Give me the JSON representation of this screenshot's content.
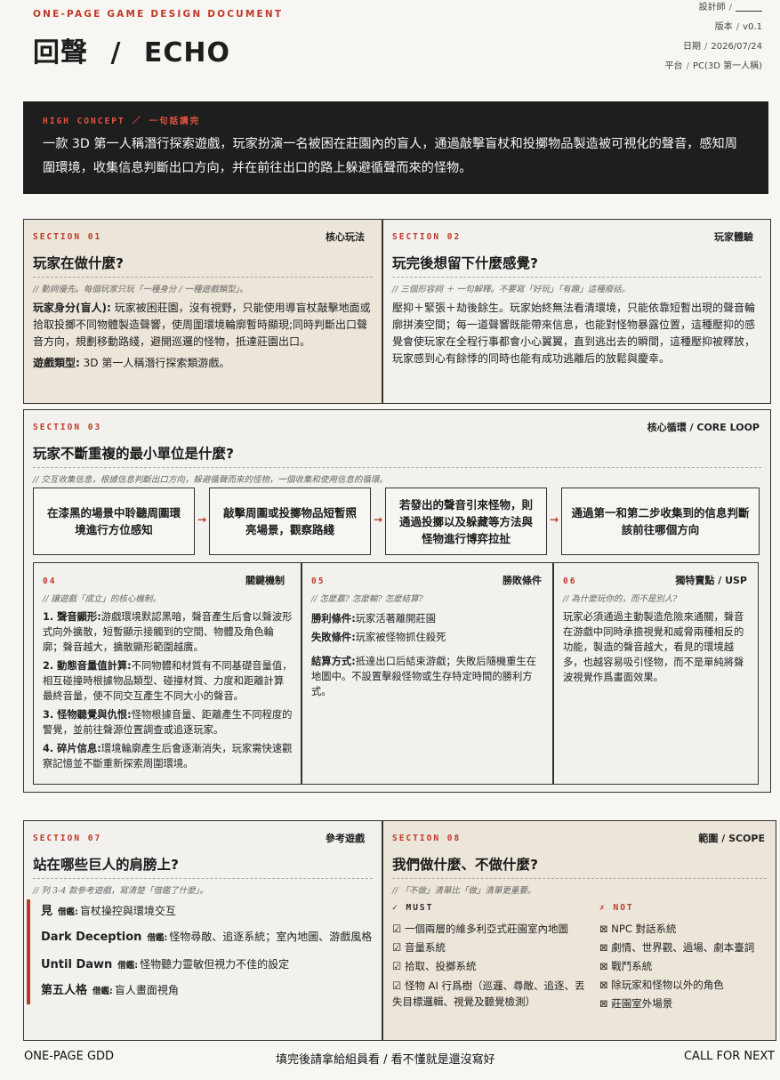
{
  "header": {
    "doc_label": "ONE-PAGE GAME DESIGN DOCUMENT",
    "title_cn": "回聲",
    "title_sep": "/",
    "title_en": "ECHO",
    "meta": [
      {
        "label": "設計師",
        "value": ""
      },
      {
        "label": "版本",
        "value": "v0.1"
      },
      {
        "label": "日期",
        "value": "2026/07/24"
      },
      {
        "label": "平台",
        "value": "PC(3D 第一人稱)"
      }
    ]
  },
  "high_concept": {
    "label": "HIGH CONCEPT ／ 一句話講完",
    "text": "一款 3D 第一人稱潛行探索遊戲，玩家扮演一名被困在莊園內的盲人，通過敲擊盲杖和投擲物品製造被可視化的聲音，感知周圍環境，收集信息判斷出口方向，并在前往出口的路上躲避循聲而來的怪物。"
  },
  "sec01": {
    "label": "SECTION 01",
    "tag": "核心玩法",
    "title": "玩家在做什麼?",
    "sub": "// 動詞優先。每個玩家只玩「一種身分 / 一種遊戲類型」。",
    "role_label": "玩家身分(盲人):",
    "role_text": " 玩家被困莊園，沒有視野，只能使用導盲杖敲擊地面或拾取投擲不同物體製造聲響，使周圍環境輪廓暫時顯現;同時判斷出口聲音方向，規劃移動路綫，避開巡邏的怪物，抵達莊園出口。",
    "genre_label": "遊戲類型:",
    "genre_text": " 3D 第一人稱潛行探索類游戲。"
  },
  "sec02": {
    "label": "SECTION 02",
    "tag": "玩家體驗",
    "title": "玩完後想留下什麼感覺?",
    "sub": "// 三個形容詞 ＋ 一句解釋。不要寫「好玩」「有趣」這種廢話。",
    "text": "壓抑＋緊張＋劫後餘生。玩家始終無法看清環境，只能依靠短暫出現的聲音輪廓拼湊空間；每一道聲響既能帶來信息，也能對怪物暴露位置，這種壓抑的感覺會使玩家在全程行事都會小心翼翼，直到逃出去的瞬間，這種壓抑被釋放，玩家感到心有餘悸的同時也能有成功逃離后的放鬆與慶幸。"
  },
  "sec03": {
    "label": "SECTION 03",
    "tag": "核心循環 / CORE LOOP",
    "title": "玩家不斷重複的最小單位是什麼?",
    "sub": "// 交互收集信息，根據信息判斷出口方向，躲避循聲而來的怪物，一個收集和使用信息的循環。",
    "loop": [
      "在漆黑的場景中聆聽周圍環境進行方位感知",
      "敲擊周圍或投擲物品短暫照亮場景，觀察路綫",
      "若發出的聲音引來怪物，則通過投擲以及躲藏等方法與怪物進行博弈拉扯",
      "通過第一和第二步收集到的信息判斷該前往哪個方向"
    ],
    "arrow": "→"
  },
  "sec04": {
    "num": "04",
    "tag": "關鍵機制",
    "sub": "// 讓遊戲「成立」的核心機制。",
    "items": [
      {
        "label": "1. 聲音顯形:",
        "text": "游戲環境默認黑暗，聲音產生后會以聲波形式向外擴散，短暫顯示接觸到的空間、物體及角色輪廓；聲音越大，擴散顯形範圍越廣。"
      },
      {
        "label": "2. 動態音量值計算:",
        "text": "不同物體和材質有不同基礎音量值，相互碰撞時根據物品類型、碰撞材質、力度和距離計算最終音量，使不同交互產生不同大小的聲音。"
      },
      {
        "label": "3. 怪物聽覺與仇恨:",
        "text": "怪物根據音量、距離產生不同程度的警覺，並前往聲源位置調查或追逐玩家。"
      },
      {
        "label": "4. 碎片信息:",
        "text": "環境輪廓產生后會逐漸消失，玩家需快速觀察記憶並不斷重新探索周圍環境。"
      }
    ]
  },
  "sec05": {
    "num": "05",
    "tag": "勝敗條件",
    "sub": "// 怎麼贏? 怎麼輸? 怎麼結算?",
    "win_label": "勝利條件:",
    "win_text": "玩家活著離開莊園",
    "lose_label": "失敗條件:",
    "lose_text": "玩家被怪物抓住殺死",
    "result_label": "結算方式:",
    "result_text": "抵達出口后結束游戲；失敗后隨機重生在地圖中。不設置擊殺怪物或生存特定時間的勝利方式。"
  },
  "sec06": {
    "num": "06",
    "tag": "獨特賣點 / USP",
    "sub": "// 為什麼玩你的，而不是別人?",
    "text": "玩家必須通過主動製造危險來通關，聲音在游戲中同時承擔視覺和威脅兩種相反的功能，製造的聲音越大，看見的環境越多，也越容易吸引怪物，而不是單純將聲波視覺作爲畫面效果。"
  },
  "sec07": {
    "label": "SECTION 07",
    "tag": "參考遊戲",
    "title": "站在哪些巨人的肩膀上?",
    "sub": "// 列 3-4 款參考遊戲，寫清楚「借鑑了什麼」。",
    "refs": [
      {
        "name": "見",
        "borrow_label": "借鑑:",
        "borrow": "盲杖操控與環境交互"
      },
      {
        "name": "Dark Deception",
        "borrow_label": "借鑑:",
        "borrow": "怪物尋敵、追逐系統；室內地圖、游戲風格"
      },
      {
        "name": "Until Dawn",
        "borrow_label": "借鑑:",
        "borrow": "怪物聽力靈敏但視力不佳的設定"
      },
      {
        "name": "第五人格",
        "borrow_label": "借鑑:",
        "borrow": "盲人畫面視角"
      }
    ]
  },
  "sec08": {
    "label": "SECTION 08",
    "tag": "範圍 / SCOPE",
    "title": "我們做什麼、不做什麼?",
    "sub": "// 「不做」清單比「做」清單更重要。",
    "must_mark": "✓",
    "must_label": "MUST",
    "not_mark": "✗",
    "not_label": "NOT",
    "must": [
      "☑ 一個兩層的維多利亞式莊園室內地圖",
      "☑ 音量系統",
      "☑ 拾取、投擲系統",
      "☑ 怪物 AI 行爲樹（巡邏、尋敵、追逐、丟失目標邏輯、視覺及聽覺檢測）"
    ],
    "not": [
      "⊠ NPC 對話系統",
      "⊠ 劇情、世界觀、過場、劇本臺詞",
      "⊠ 戰鬥系統",
      "⊠ 除玩家和怪物以外的角色",
      "⊠ 莊園室外場景"
    ]
  },
  "footer": {
    "left": "ONE-PAGE GDD",
    "center": "填完後請拿給組員看 / 看不懂就是還沒寫好",
    "right": "CALL FOR NEXT"
  }
}
